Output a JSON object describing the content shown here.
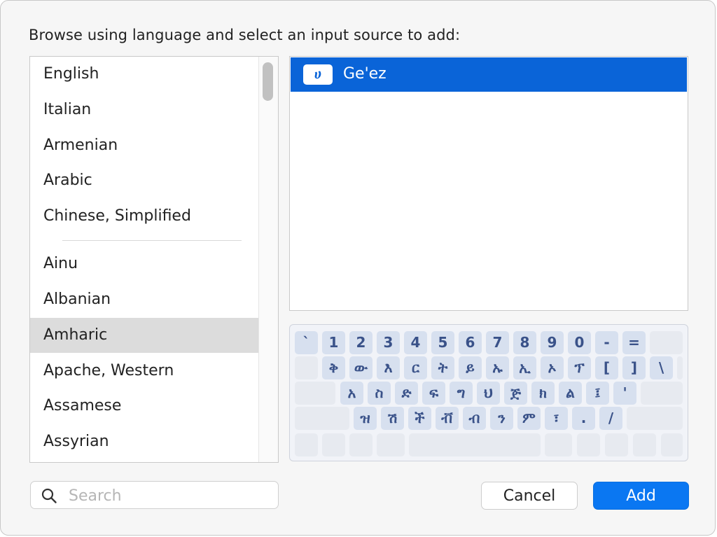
{
  "dialog": {
    "prompt": "Browse using language and select an input source to add:"
  },
  "languages": {
    "items": [
      {
        "label": "English"
      },
      {
        "label": "Italian"
      },
      {
        "label": "Armenian"
      },
      {
        "label": "Arabic"
      },
      {
        "label": "Chinese, Simplified"
      },
      {
        "label": "Ainu"
      },
      {
        "label": "Albanian"
      },
      {
        "label": "Amharic",
        "selected": true
      },
      {
        "label": "Apache, Western"
      },
      {
        "label": "Assamese"
      },
      {
        "label": "Assyrian"
      }
    ]
  },
  "sources": {
    "items": [
      {
        "icon_glyph": "ሀ",
        "icon": "geez-keyboard-icon",
        "label": "Ge'ez",
        "selected": true
      }
    ]
  },
  "keyboard": {
    "rows": [
      [
        "`",
        "1",
        "2",
        "3",
        "4",
        "5",
        "6",
        "7",
        "8",
        "9",
        "0",
        "-",
        "="
      ],
      [
        "ቅ",
        "ው",
        "እ",
        "ር",
        "ት",
        "ይ",
        "ኡ",
        "ኢ",
        "ኦ",
        "ፕ",
        "[",
        "]",
        "\\"
      ],
      [
        "አ",
        "ስ",
        "ድ",
        "ፍ",
        "ግ",
        "ህ",
        "ጅ",
        "ክ",
        "ል",
        "፤",
        "'"
      ],
      [
        "ዝ",
        "ሽ",
        "ች",
        "ቭ",
        "ብ",
        "ን",
        "ም",
        "፣",
        ".",
        "/"
      ]
    ]
  },
  "search": {
    "placeholder": "Search",
    "value": ""
  },
  "buttons": {
    "cancel": "Cancel",
    "add": "Add"
  },
  "colors": {
    "accent": "#0a64d8",
    "add_button": "#0a77f2",
    "key_fill": "#d7e0ef",
    "key_text": "#3a5289"
  }
}
